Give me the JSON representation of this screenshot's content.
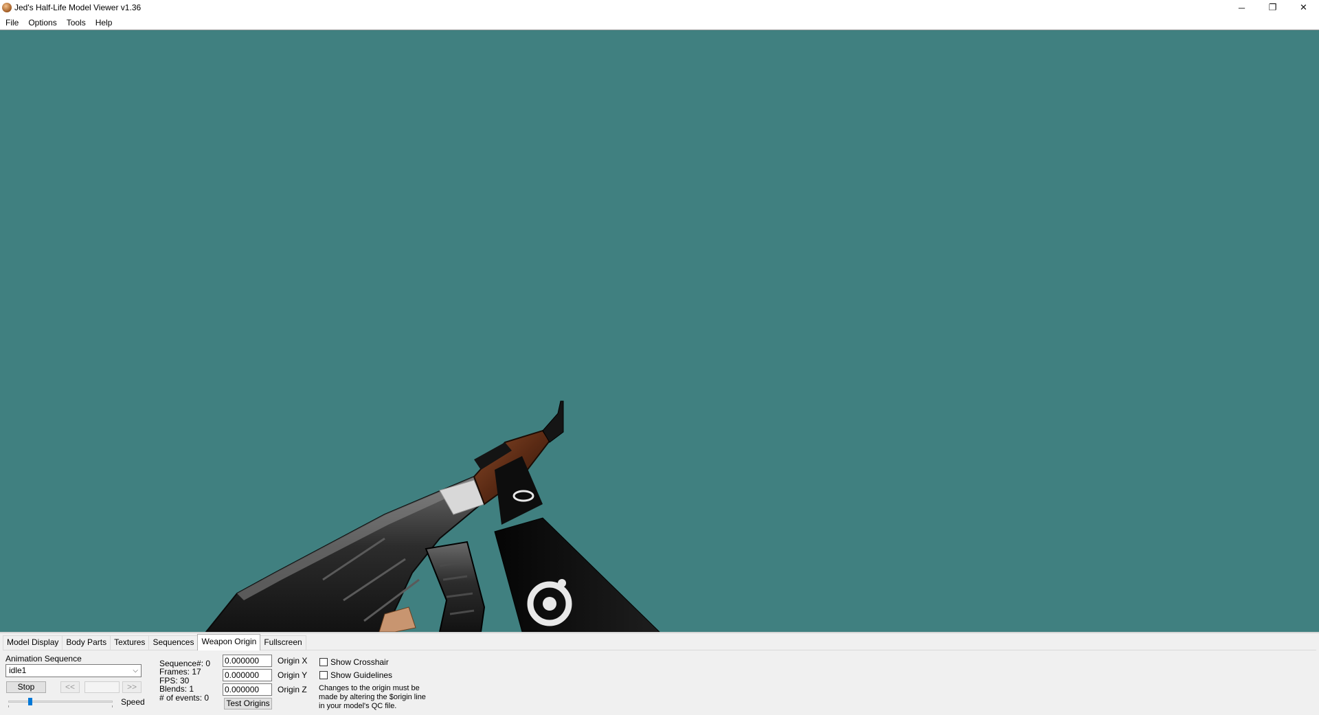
{
  "window": {
    "title": "Jed's Half-Life Model Viewer v1.36",
    "controls": {
      "minimize": "─",
      "restore": "❐",
      "close": "✕"
    }
  },
  "menu": [
    "File",
    "Options",
    "Tools",
    "Help"
  ],
  "viewport": {
    "background": "#408080"
  },
  "tabs": [
    {
      "label": "Model Display"
    },
    {
      "label": "Body Parts"
    },
    {
      "label": "Textures"
    },
    {
      "label": "Sequences"
    },
    {
      "label": "Weapon Origin",
      "active": true
    },
    {
      "label": "Fullscreen"
    }
  ],
  "animation": {
    "label": "Animation Sequence",
    "selected": "idle1",
    "stop_label": "Stop",
    "prev_label": "<<",
    "next_label": ">>",
    "frame_value": "",
    "speed_label": "Speed",
    "speed_fraction": 0.2
  },
  "sequence_info": {
    "sequence": "Sequence#: 0",
    "frames": "Frames: 17",
    "fps": "FPS: 30",
    "blends": "Blends: 1",
    "events": "# of events: 0"
  },
  "origin": {
    "x_value": "0.000000",
    "x_label": "Origin X",
    "y_value": "0.000000",
    "y_label": "Origin Y",
    "z_value": "0.000000",
    "z_label": "Origin Z",
    "test_label": "Test Origins"
  },
  "options": {
    "crosshair_label": "Show Crosshair",
    "crosshair_checked": false,
    "guidelines_label": "Show Guidelines",
    "guidelines_checked": false,
    "note_line1": "Changes to the origin must be",
    "note_line2": "made by altering the $origin line",
    "note_line3": "in your model's QC file."
  }
}
